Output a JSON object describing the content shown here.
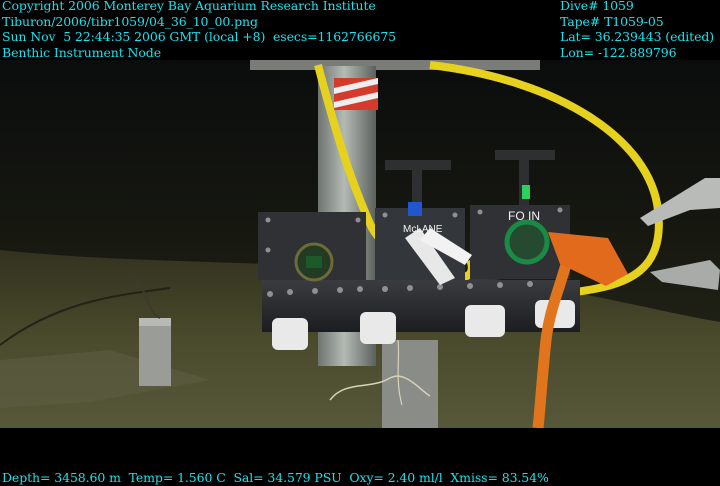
{
  "overlay": {
    "top_left": [
      "Copyright 2006 Monterey Bay Aquarium Research Institute",
      "Tiburon/2006/tibr1059/04_36_10_00.png",
      "Sun Nov  5 22:44:35 2006 GMT (local +8)  esecs=1162766675",
      "Benthic Instrument Node"
    ],
    "top_right": [
      "Dive# 1059",
      "Tape# T1059-05",
      "Lat= 36.239443 (edited)",
      "Lon= -122.889796"
    ],
    "bottom": "Depth= 3458.60 m  Temp= 1.560 C  Sal= 34.579 PSU  Oxy= 2.40 ml/l  Xmiss= 83.54%"
  },
  "scene_labels": {
    "connector_left": "McLANE",
    "connector_right": "FO IN"
  },
  "colors": {
    "overlay_text": "#17e3ef",
    "seafloor": "#4a4a2c",
    "cable_yellow": "#e6d21e",
    "cable_orange": "#e0751e"
  }
}
